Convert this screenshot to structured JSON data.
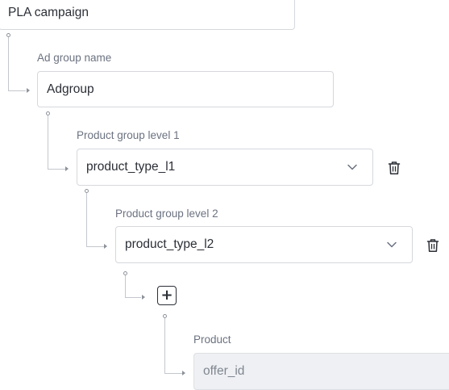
{
  "campaign": {
    "name": "PLA campaign"
  },
  "ad_group": {
    "label": "Ad group name",
    "value": "Adgroup"
  },
  "product_group_1": {
    "label": "Product group level 1",
    "value": "product_type_l1"
  },
  "product_group_2": {
    "label": "Product group level 2",
    "value": "product_type_l2"
  },
  "add_button": {
    "symbol": "+"
  },
  "product": {
    "label": "Product",
    "value": "offer_id"
  },
  "icons": {
    "dropdown": "chevron-down-icon",
    "delete": "trash-icon",
    "add": "plus-icon"
  }
}
